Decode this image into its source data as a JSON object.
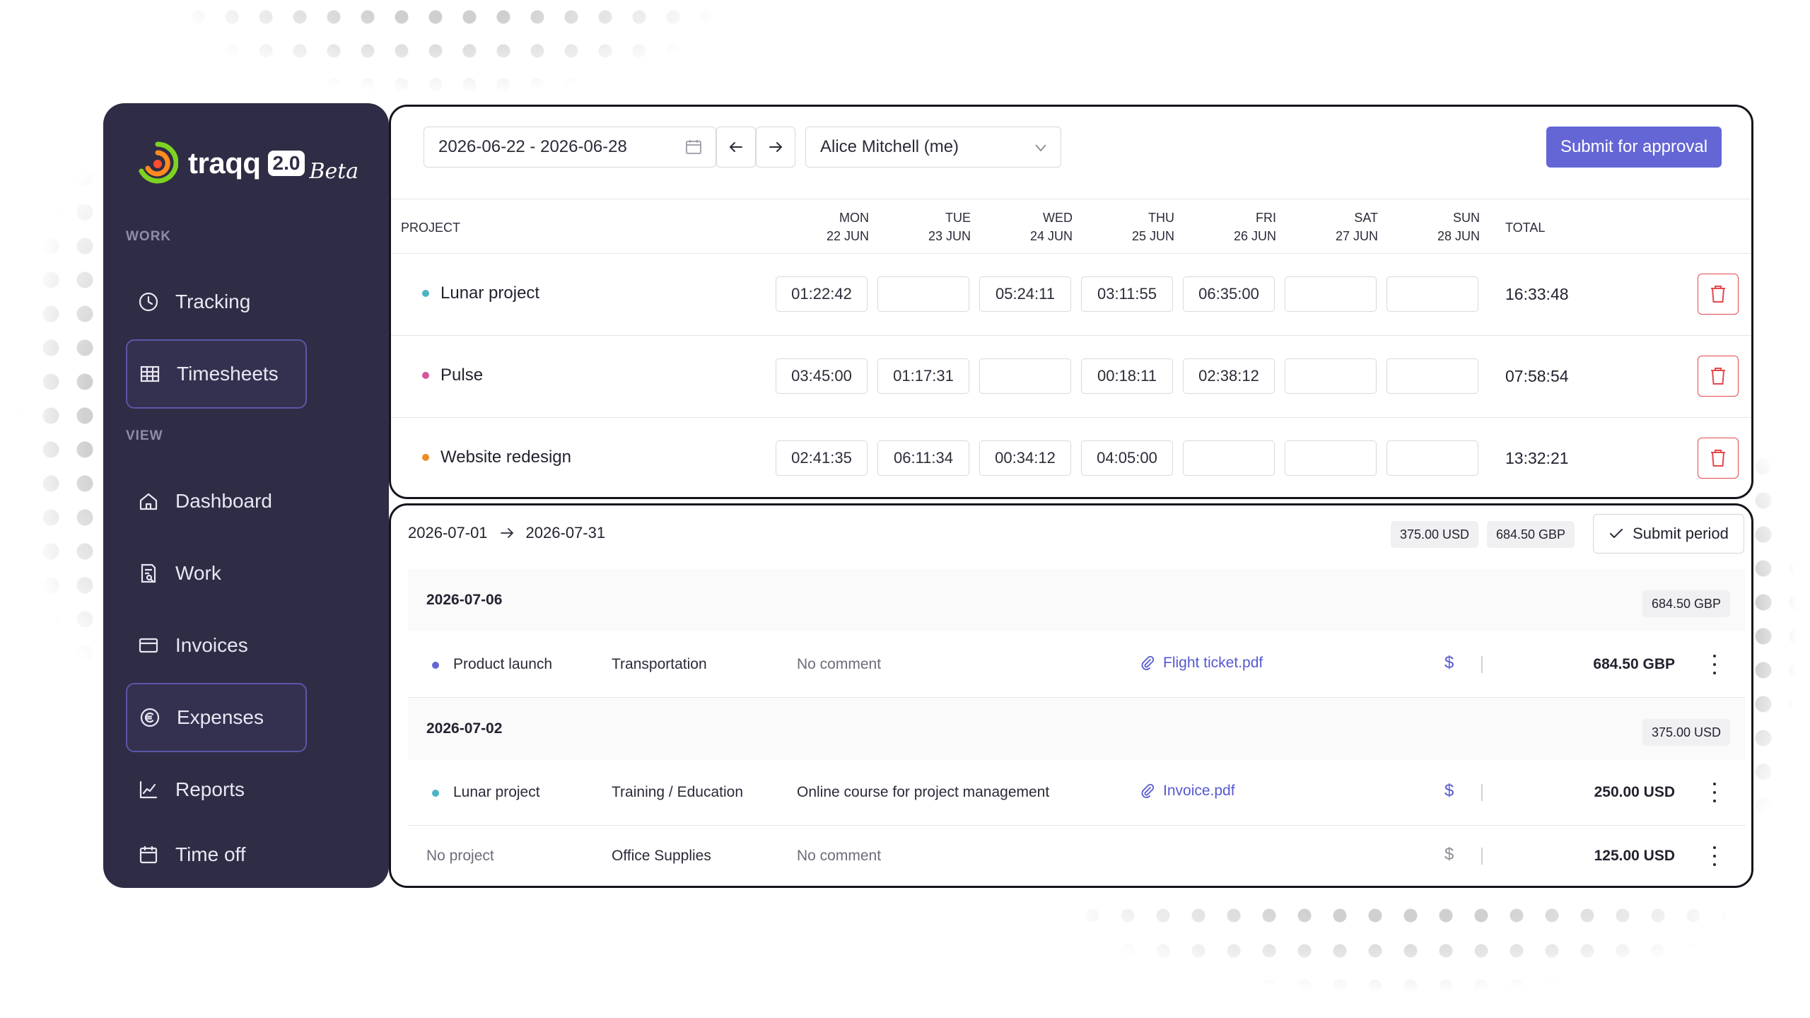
{
  "brand": {
    "name": "traqq",
    "version": "2.0",
    "tag": "Beta"
  },
  "sidebar": {
    "sections": [
      {
        "label": "WORK"
      },
      {
        "label": "VIEW"
      }
    ],
    "items": [
      {
        "label": "Tracking",
        "icon": "clock-icon"
      },
      {
        "label": "Timesheets",
        "icon": "grid-icon",
        "active": true
      },
      {
        "label": "Dashboard",
        "icon": "home-icon"
      },
      {
        "label": "Work",
        "icon": "document-search-icon"
      },
      {
        "label": "Invoices",
        "icon": "wallet-icon"
      },
      {
        "label": "Expenses",
        "icon": "euro-icon",
        "active": true
      },
      {
        "label": "Reports",
        "icon": "line-chart-icon"
      },
      {
        "label": "Time off",
        "icon": "calendar-icon"
      }
    ]
  },
  "timesheet": {
    "date_range": "2026-06-22 - 2026-06-28",
    "user": "Alice Mitchell (me)",
    "submit_label": "Submit for approval",
    "headers": {
      "project": "PROJECT",
      "days": [
        {
          "day": "MON",
          "date": "22 JUN"
        },
        {
          "day": "TUE",
          "date": "23 JUN"
        },
        {
          "day": "WED",
          "date": "24 JUN"
        },
        {
          "day": "THU",
          "date": "25 JUN"
        },
        {
          "day": "FRI",
          "date": "26 JUN"
        },
        {
          "day": "SAT",
          "date": "27 JUN"
        },
        {
          "day": "SUN",
          "date": "28 JUN"
        }
      ],
      "total": "TOTAL"
    },
    "rows": [
      {
        "project": "Lunar project",
        "color": "#4bb3c8",
        "times": [
          "01:22:42",
          "",
          "05:24:11",
          "03:11:55",
          "06:35:00",
          "",
          ""
        ],
        "total": "16:33:48"
      },
      {
        "project": "Pulse",
        "color": "#d6559b",
        "times": [
          "03:45:00",
          "01:17:31",
          "",
          "00:18:11",
          "02:38:12",
          "",
          ""
        ],
        "total": "07:58:54"
      },
      {
        "project": "Website redesign",
        "color": "#f08a24",
        "times": [
          "02:41:35",
          "06:11:34",
          "00:34:12",
          "04:05:00",
          "",
          "",
          ""
        ],
        "total": "13:32:21"
      }
    ]
  },
  "expenses": {
    "period_start": "2026-07-01",
    "period_end": "2026-07-31",
    "totals": [
      "375.00 USD",
      "684.50 GBP"
    ],
    "submit_label": "Submit period",
    "groups": [
      {
        "date": "2026-07-06",
        "total": "684.50 GBP",
        "items": [
          {
            "project": "Product launch",
            "dot_color": "#6466d6",
            "category": "Transportation",
            "comment": "No comment",
            "attachment": "Flight ticket.pdf",
            "amount": "684.50 GBP"
          }
        ]
      },
      {
        "date": "2026-07-02",
        "total": "375.00 USD",
        "items": [
          {
            "project": "Lunar project",
            "dot_color": "#4bb3c8",
            "category": "Training / Education",
            "comment": "Online course for project management",
            "attachment": "Invoice.pdf",
            "amount": "250.00 USD"
          },
          {
            "project": "No project",
            "dot_color": "",
            "category": "Office Supplies",
            "comment": "No comment",
            "attachment": "",
            "amount": "125.00 USD"
          }
        ]
      }
    ],
    "currency_symbol": "$"
  },
  "colors": {
    "sidebar": "#2f2d45",
    "accent": "#6466d6",
    "danger": "#e5484d"
  }
}
